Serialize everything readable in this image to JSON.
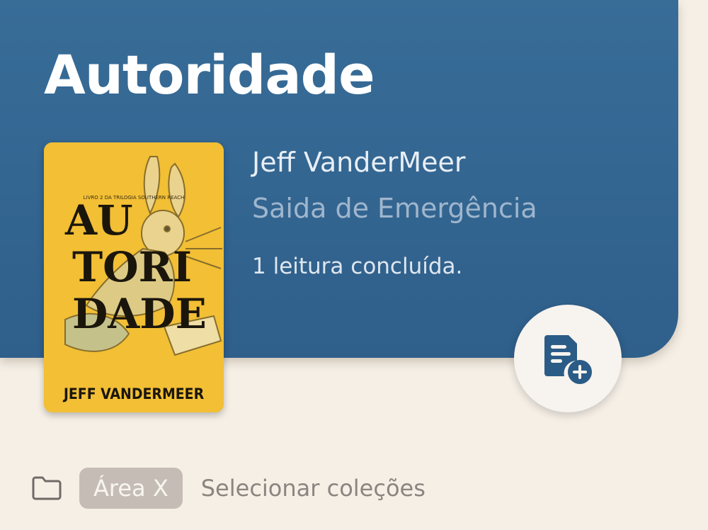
{
  "book": {
    "title": "Autoridade",
    "author": "Jeff VanderMeer",
    "publisher": "Saida de Emergência",
    "reads": "1 leitura concluída.",
    "cover": {
      "tagline": "LIVRO 2 DA TRILOGIA SOUTHERN REACH",
      "title_line1": "AU",
      "title_line2": "TORI",
      "title_line3": "DADE",
      "author": "JEFF VANDERMEER",
      "background_color": "#f2bf35"
    }
  },
  "collections": {
    "icon": "folder-icon",
    "chip_label": "Área X",
    "select_label": "Selecionar coleções"
  },
  "actions": {
    "add_note_icon": "note-add-icon"
  },
  "colors": {
    "header": "#336691",
    "background": "#f5efe6",
    "accent": "#2f5f8b"
  }
}
